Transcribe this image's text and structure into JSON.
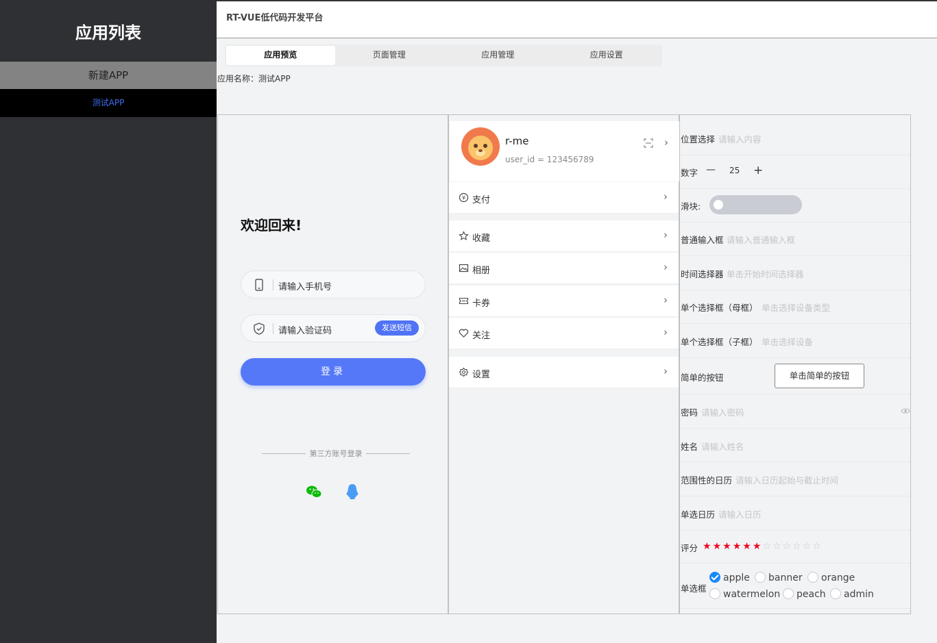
{
  "sidebar": {
    "title": "应用列表",
    "new_app": "新建APP",
    "apps": [
      "测试APP"
    ]
  },
  "header": {
    "title": "RT-VUE低代码开发平台"
  },
  "tabs": [
    "应用预览",
    "页面管理",
    "应用管理",
    "应用设置"
  ],
  "app_name": "应用名称：测试APP",
  "login": {
    "welcome": "欢迎回来!",
    "phone_placeholder": "请输入手机号",
    "code_placeholder": "请输入验证码",
    "sms_button": "发送短信",
    "login_button": "登录",
    "third_party": "第三方账号登录"
  },
  "profile": {
    "username": "r-me",
    "user_id": "user_id = 123456789",
    "menu": [
      "支付",
      "收藏",
      "相册",
      "卡券",
      "关注",
      "设置"
    ]
  },
  "form": {
    "position_label": "位置选择",
    "position_placeholder": "请输入内容",
    "number_label": "数字",
    "number_value": "25",
    "minus": "—",
    "plus": "+",
    "slider_label": "滑块:",
    "slider_value": 0,
    "input_label": "普通输入框",
    "input_placeholder": "请输入普通输入框",
    "time_label": "时间选择器",
    "time_placeholder": "单击开始时间选择器",
    "parent_select_label": "单个选择框（母框）",
    "parent_select_placeholder": "单击选择设备类型",
    "child_select_label": "单个选择框（子框）",
    "child_select_placeholder": "单击选择设备",
    "button_label": "简单的按钮",
    "button_text": "单击简单的按钮",
    "password_label": "密码",
    "password_placeholder": "请输入密码",
    "name_label": "姓名",
    "name_placeholder": "请输入姓名",
    "range_calendar_label": "范围性的日历",
    "range_calendar_placeholder": "请输入日历起始与截止时间",
    "calendar_label": "单选日历",
    "calendar_placeholder": "请输入日历",
    "rating_label": "评分",
    "rating_value": 6,
    "rating_max": 12,
    "radio_label": "单选框",
    "radio_options": [
      "apple",
      "banner",
      "orange",
      "watermelon",
      "peach",
      "admin"
    ],
    "radio_selected": "apple"
  },
  "colors": {
    "sidebar_bg": "#2f3033",
    "primary": "#5478f7",
    "link": "#3d6ff0",
    "star": "#ee0a24",
    "check": "#1989fa"
  }
}
